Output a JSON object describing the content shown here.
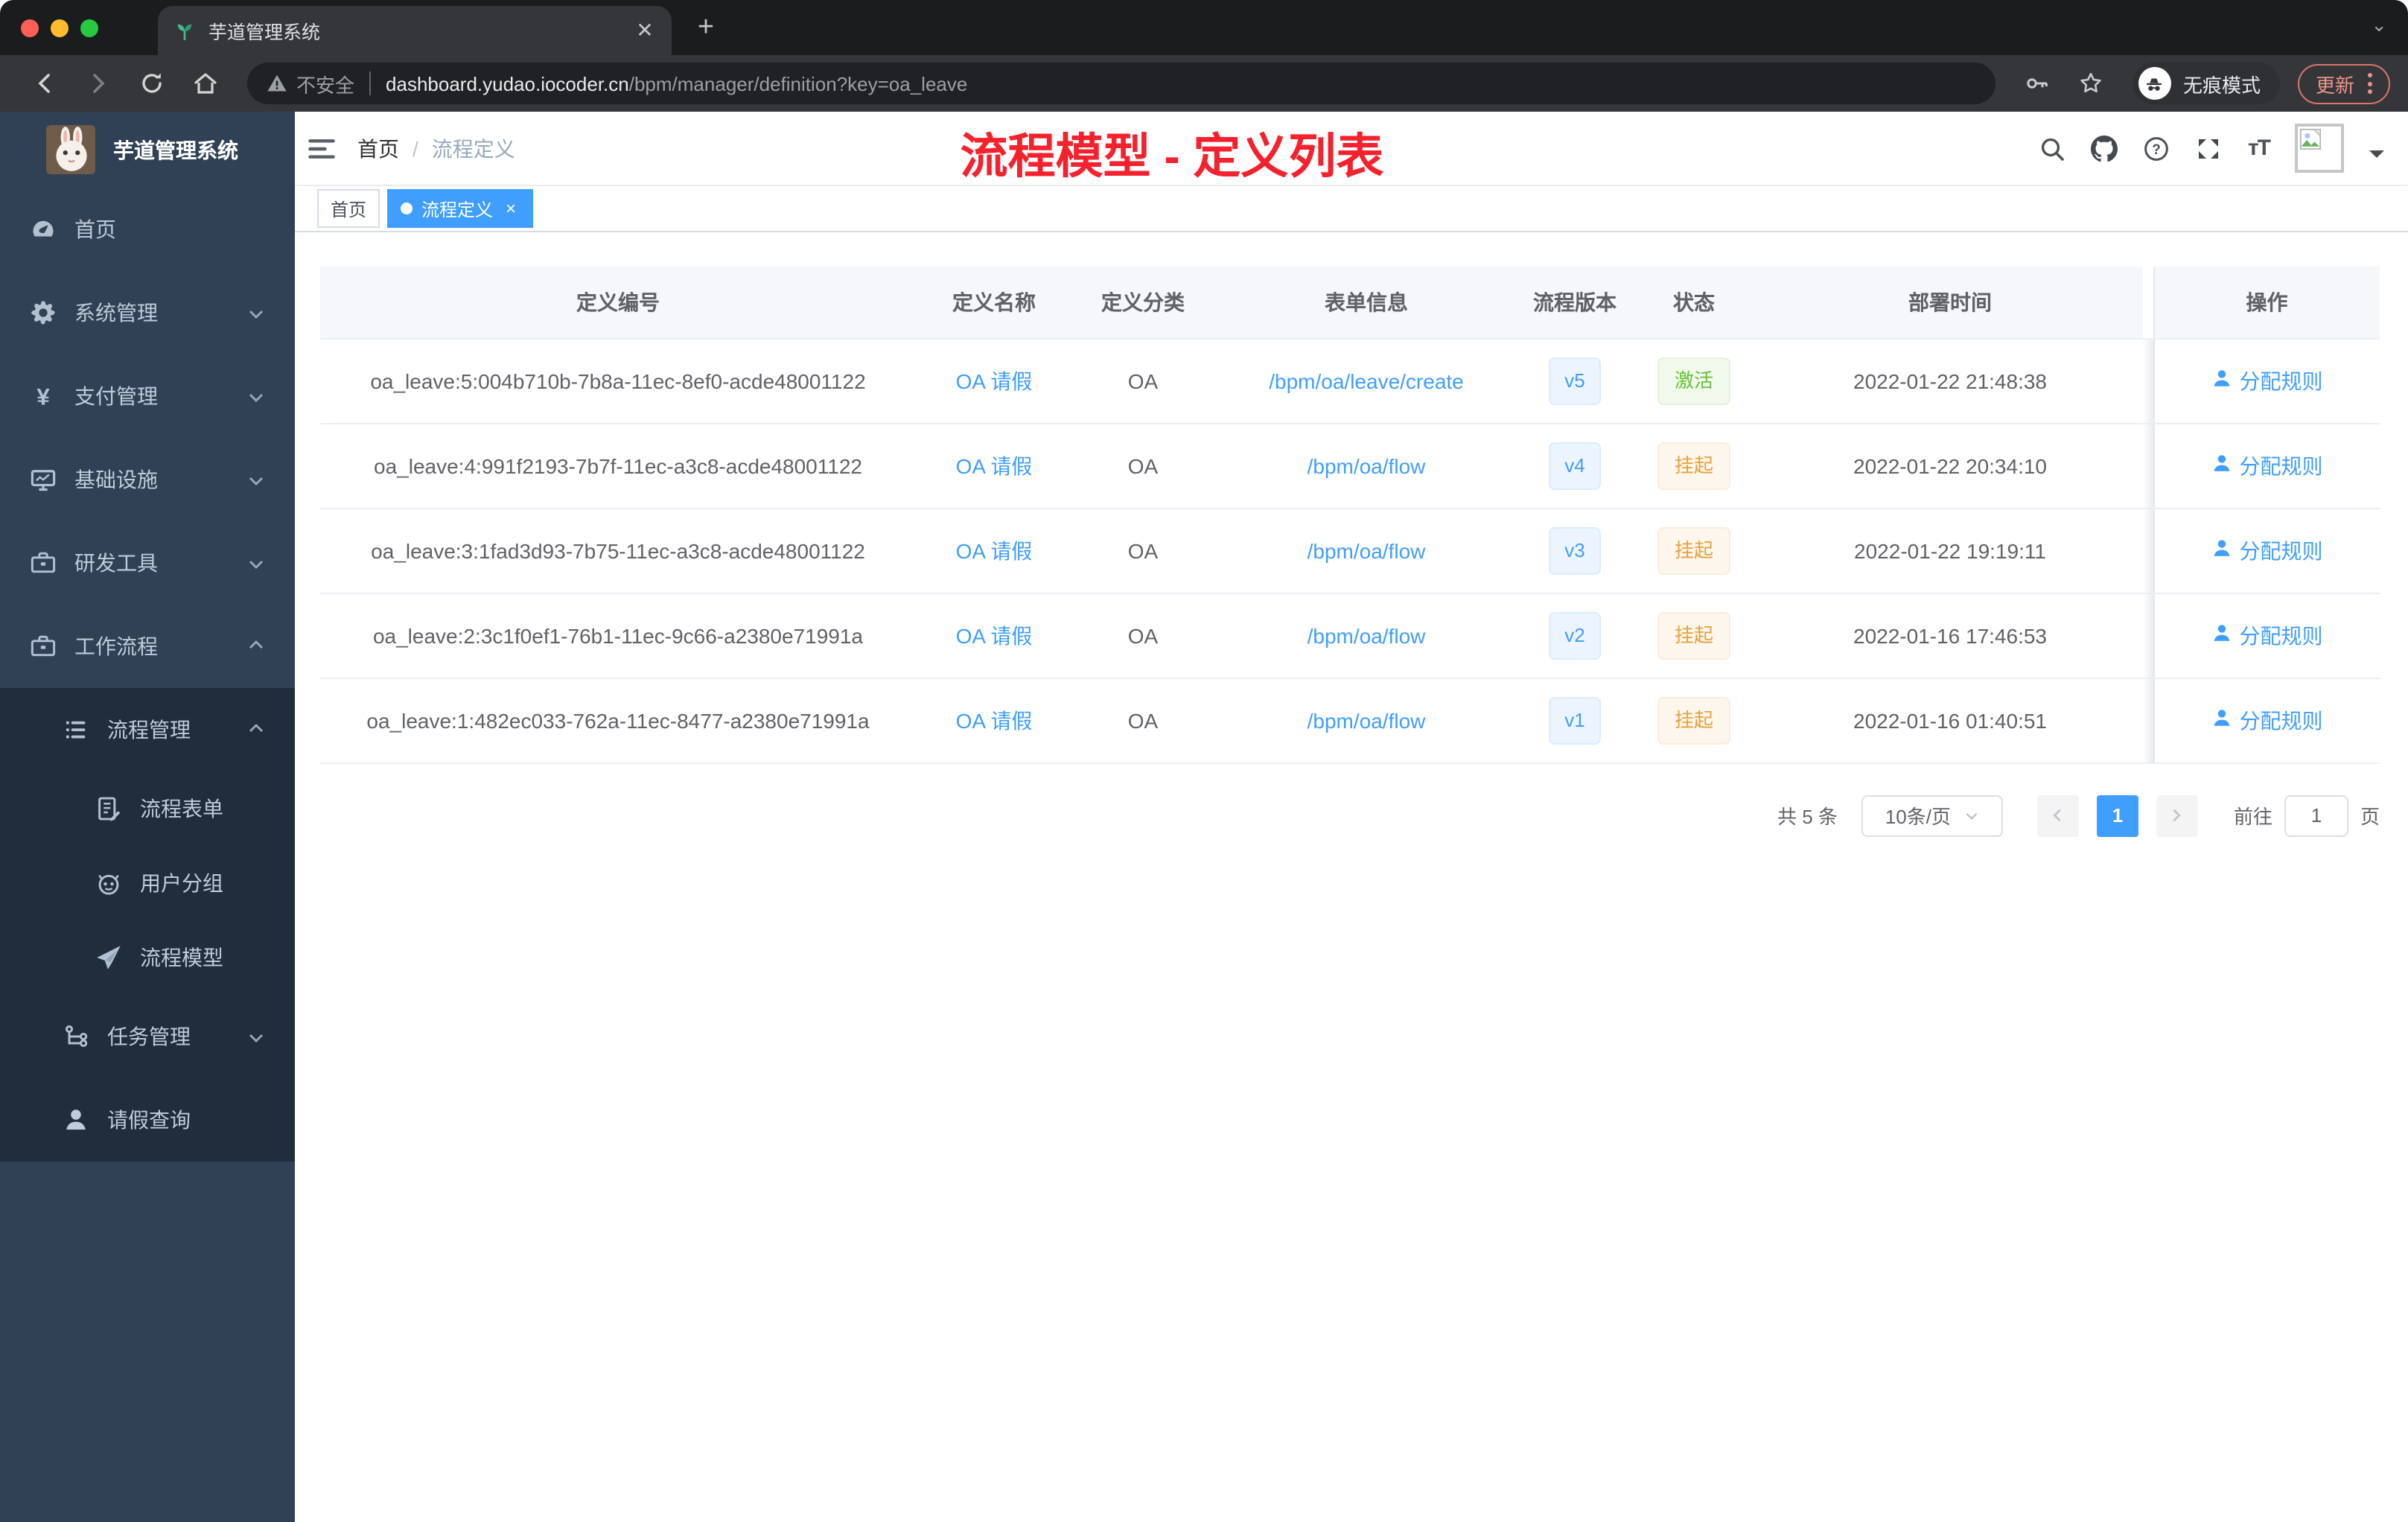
{
  "browser": {
    "tab_title": "芋道管理系统",
    "security_label": "不安全",
    "url_host": "dashboard.yudao.iocoder.cn",
    "url_path": "/bpm/manager/definition?key=oa_leave",
    "incognito_label": "无痕模式",
    "update_label": "更新"
  },
  "sidebar": {
    "title": "芋道管理系统",
    "items": [
      {
        "key": "home",
        "label": "首页",
        "icon": "dashboard-icon",
        "level": 0
      },
      {
        "key": "system",
        "label": "系统管理",
        "icon": "gear-icon",
        "level": 0,
        "arrow": "down"
      },
      {
        "key": "payment",
        "label": "支付管理",
        "icon": "yen-icon",
        "level": 0,
        "arrow": "down"
      },
      {
        "key": "infra",
        "label": "基础设施",
        "icon": "monitor-icon",
        "level": 0,
        "arrow": "down"
      },
      {
        "key": "devtools",
        "label": "研发工具",
        "icon": "toolbox-icon",
        "level": 0,
        "arrow": "down"
      },
      {
        "key": "workflow",
        "label": "工作流程",
        "icon": "briefcase-icon",
        "level": 0,
        "arrow": "up"
      },
      {
        "key": "process-manage",
        "label": "流程管理",
        "icon": "list-icon",
        "level": 1,
        "arrow": "up",
        "sub": true
      },
      {
        "key": "process-form",
        "label": "流程表单",
        "icon": "form-icon",
        "level": 2,
        "sub": true
      },
      {
        "key": "user-group",
        "label": "用户分组",
        "icon": "robot-icon",
        "level": 2,
        "sub": true
      },
      {
        "key": "process-model",
        "label": "流程模型",
        "icon": "send-icon",
        "level": 2,
        "sub": true
      },
      {
        "key": "task-manage",
        "label": "任务管理",
        "icon": "tree-icon",
        "level": 1,
        "arrow": "down",
        "sub": true
      },
      {
        "key": "leave-query",
        "label": "请假查询",
        "icon": "user-icon",
        "level": 1,
        "sub": true
      }
    ]
  },
  "navbar": {
    "breadcrumb": [
      "首页",
      "流程定义"
    ],
    "annotation": "流程模型 - 定义列表"
  },
  "tags": [
    {
      "label": "首页",
      "active": false
    },
    {
      "label": "流程定义",
      "active": true
    }
  ],
  "table": {
    "columns": [
      "定义编号",
      "定义名称",
      "定义分类",
      "表单信息",
      "流程版本",
      "状态",
      "部署时间",
      "操作"
    ],
    "rows": [
      {
        "id": "oa_leave:5:004b710b-7b8a-11ec-8ef0-acde48001122",
        "name": "OA 请假",
        "category": "OA",
        "form": "/bpm/oa/leave/create",
        "version": "v5",
        "status": "激活",
        "status_type": "success",
        "deploy_time": "2022-01-22 21:48:38",
        "action": "分配规则"
      },
      {
        "id": "oa_leave:4:991f2193-7b7f-11ec-a3c8-acde48001122",
        "name": "OA 请假",
        "category": "OA",
        "form": "/bpm/oa/flow",
        "version": "v4",
        "status": "挂起",
        "status_type": "warning",
        "deploy_time": "2022-01-22 20:34:10",
        "action": "分配规则"
      },
      {
        "id": "oa_leave:3:1fad3d93-7b75-11ec-a3c8-acde48001122",
        "name": "OA 请假",
        "category": "OA",
        "form": "/bpm/oa/flow",
        "version": "v3",
        "status": "挂起",
        "status_type": "warning",
        "deploy_time": "2022-01-22 19:19:11",
        "action": "分配规则"
      },
      {
        "id": "oa_leave:2:3c1f0ef1-76b1-11ec-9c66-a2380e71991a",
        "name": "OA 请假",
        "category": "OA",
        "form": "/bpm/oa/flow",
        "version": "v2",
        "status": "挂起",
        "status_type": "warning",
        "deploy_time": "2022-01-16 17:46:53",
        "action": "分配规则"
      },
      {
        "id": "oa_leave:1:482ec033-762a-11ec-8477-a2380e71991a",
        "name": "OA 请假",
        "category": "OA",
        "form": "/bpm/oa/flow",
        "version": "v1",
        "status": "挂起",
        "status_type": "warning",
        "deploy_time": "2022-01-16 01:40:51",
        "action": "分配规则"
      }
    ]
  },
  "pagination": {
    "total": "共 5 条",
    "page_size": "10条/页",
    "current_page": "1",
    "goto_label": "前往",
    "goto_value": "1",
    "page_unit": "页"
  },
  "colors": {
    "primary": "#409eff",
    "success": "#67c23a",
    "warning": "#e6a23c",
    "annotation_red": "#f5222d",
    "sidebar_bg": "#304156",
    "sidebar_sub_bg": "#1f2d3d"
  }
}
